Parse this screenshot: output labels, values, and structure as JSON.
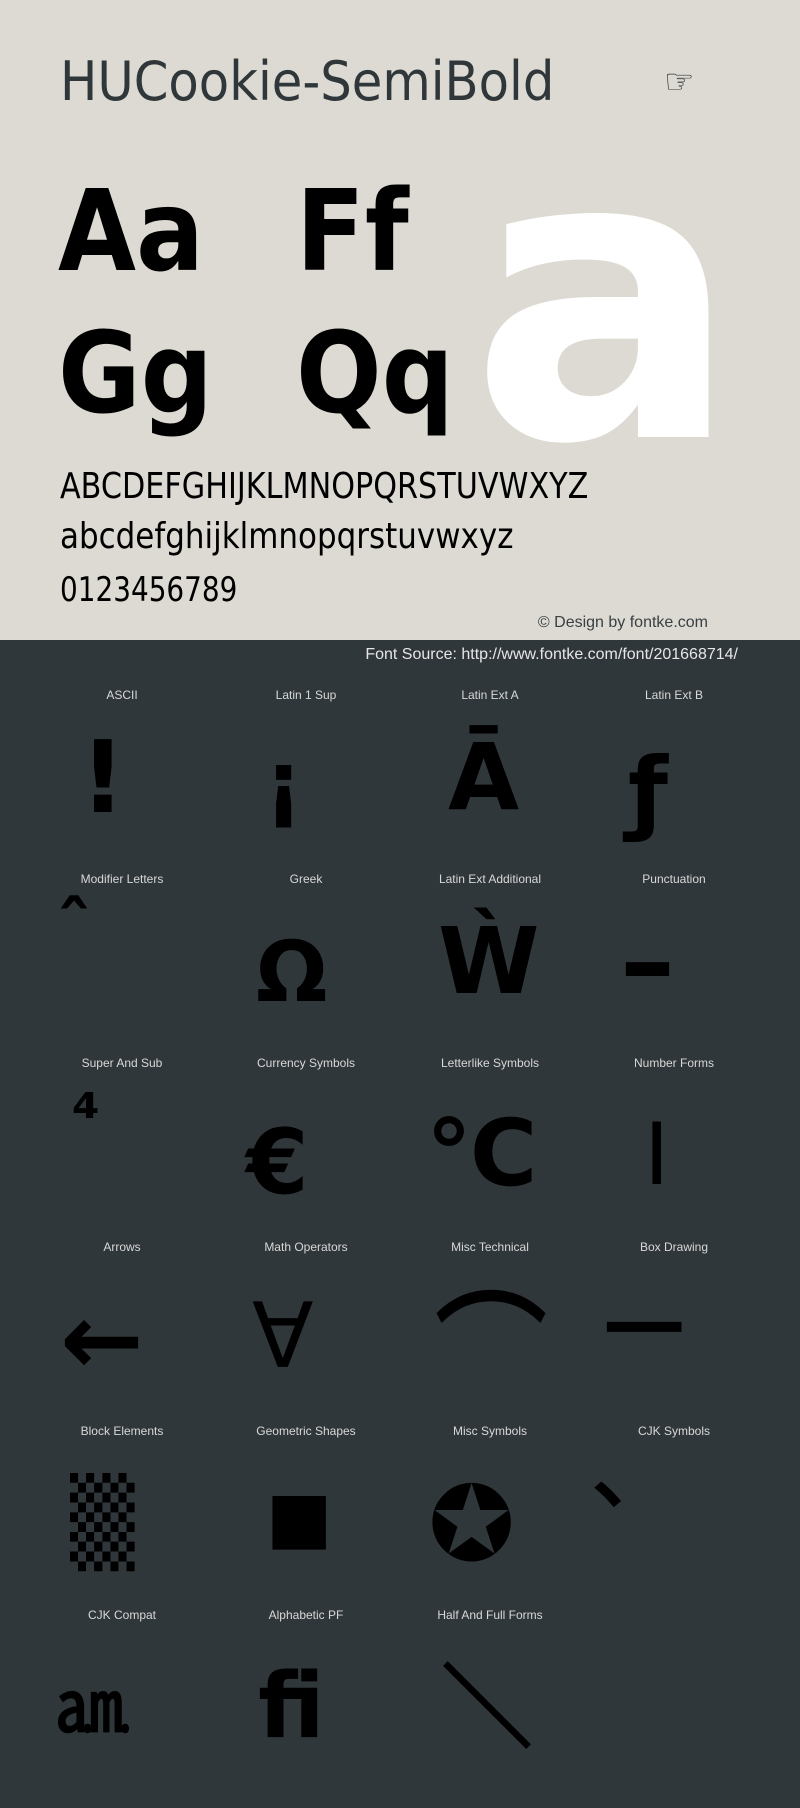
{
  "header": {
    "font_name": "HUCookie-SemiBold",
    "pointer_icon": "☞"
  },
  "specimen": {
    "pairs": [
      "Aa",
      "Ff",
      "Gg",
      "Qq"
    ],
    "hero_glyph": "a",
    "uppercase": "ABCDEFGHIJKLMNOPQRSTUVWXYZ",
    "lowercase": "abcdefghijklmnopqrstuvwxyz",
    "digits": "0123456789",
    "credit": "© Design by fontke.com"
  },
  "source": "Font Source: http://www.fontke.com/font/201668714/",
  "blocks": [
    {
      "label": "ASCII",
      "glyph": "!"
    },
    {
      "label": "Latin 1 Sup",
      "glyph": "¡"
    },
    {
      "label": "Latin Ext A",
      "glyph": "Ā"
    },
    {
      "label": "Latin Ext B",
      "glyph": "ƒ"
    },
    {
      "label": "Modifier Letters",
      "glyph": "ˆ"
    },
    {
      "label": "Greek",
      "glyph": "Ω"
    },
    {
      "label": "Latin Ext Additional",
      "glyph": "Ẁ"
    },
    {
      "label": "Punctuation",
      "glyph": "–"
    },
    {
      "label": "Super And Sub",
      "glyph": "⁴"
    },
    {
      "label": "Currency Symbols",
      "glyph": "€"
    },
    {
      "label": "Letterlike Symbols",
      "glyph": "℃"
    },
    {
      "label": "Number Forms",
      "glyph": "Ⅰ"
    },
    {
      "label": "Arrows",
      "glyph": "←"
    },
    {
      "label": "Math Operators",
      "glyph": "∀"
    },
    {
      "label": "Misc Technical",
      "glyph": "⌒"
    },
    {
      "label": "Box Drawing",
      "glyph": "─"
    },
    {
      "label": "Block Elements",
      "glyph": "▒"
    },
    {
      "label": "Geometric Shapes",
      "glyph": "■"
    },
    {
      "label": "Misc Symbols",
      "glyph": "✪"
    },
    {
      "label": "CJK Symbols",
      "glyph": "、"
    },
    {
      "label": "CJK Compat",
      "glyph": "㏂"
    },
    {
      "label": "Alphabetic PF",
      "glyph": "ﬁ"
    },
    {
      "label": "Half And Full Forms",
      "glyph": "＼"
    }
  ],
  "colors": {
    "top_background": "#dcdad2",
    "bottom_background": "#30373a",
    "title_text": "#30373a",
    "hero_glyph": "#ffffff",
    "label_text": "#d8d8d8"
  }
}
